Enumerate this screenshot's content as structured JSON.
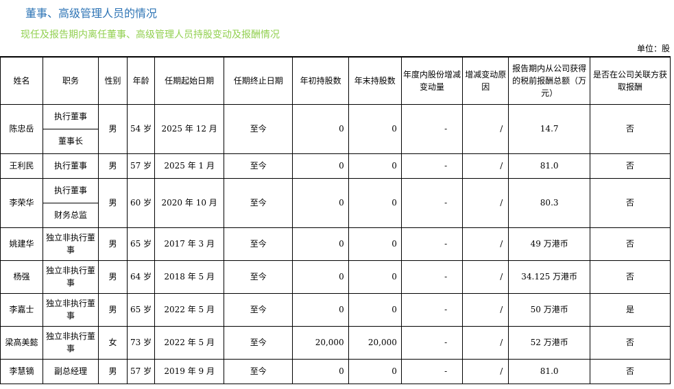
{
  "heading": "董事、高级管理人员的情况",
  "subheading": "现任及报告期内离任董事、高级管理人员持股变动及报酬情况",
  "unit": "单位：股",
  "columns": [
    "姓名",
    "职务",
    "性别",
    "年龄",
    "任期起始日期",
    "任期终止日期",
    "年初持股数",
    "年末持股数",
    "年度内股份增减变动量",
    "增减变动原因",
    "报告期内从公司获得的税前报酬总额（万元）",
    "是否在公司关联方获取报酬"
  ],
  "rows": [
    {
      "name": "陈忠岳",
      "roles": [
        "执行董事",
        "董事长"
      ],
      "gender": "男",
      "age": "54 岁",
      "start": "2025 年 12 月",
      "end": "至今",
      "begin_shares": "0",
      "end_shares": "0",
      "change": "-",
      "reason": "/",
      "pay": "14.7",
      "related": "否"
    },
    {
      "name": "王利民",
      "roles": [
        "执行董事"
      ],
      "gender": "男",
      "age": "57 岁",
      "start": "2025 年 1 月",
      "end": "至今",
      "begin_shares": "0",
      "end_shares": "0",
      "change": "-",
      "reason": "/",
      "pay": "81.0",
      "related": "否"
    },
    {
      "name": "李荣华",
      "roles": [
        "执行董事",
        "财务总监"
      ],
      "gender": "男",
      "age": "60 岁",
      "start": "2020 年 10 月",
      "end": "至今",
      "begin_shares": "0",
      "end_shares": "0",
      "change": "-",
      "reason": "/",
      "pay": "80.3",
      "related": "否"
    },
    {
      "name": "姚建华",
      "roles": [
        "独立非执行董事"
      ],
      "gender": "男",
      "age": "65 岁",
      "start": "2017 年 3 月",
      "end": "至今",
      "begin_shares": "0",
      "end_shares": "0",
      "change": "-",
      "reason": "/",
      "pay": "49 万港币",
      "related": "否"
    },
    {
      "name": "杨强",
      "roles": [
        "独立非执行董事"
      ],
      "gender": "男",
      "age": "64 岁",
      "start": "2018 年 5 月",
      "end": "至今",
      "begin_shares": "0",
      "end_shares": "0",
      "change": "-",
      "reason": "/",
      "pay": "34.125 万港币",
      "related": "否"
    },
    {
      "name": "李嘉士",
      "roles": [
        "独立非执行董事"
      ],
      "gender": "男",
      "age": "65 岁",
      "start": "2022 年 5 月",
      "end": "至今",
      "begin_shares": "0",
      "end_shares": "0",
      "change": "-",
      "reason": "/",
      "pay": "50 万港币",
      "related": "是"
    },
    {
      "name": "梁高美懿",
      "roles": [
        "独立非执行董事"
      ],
      "gender": "女",
      "age": "73 岁",
      "start": "2022 年 5 月",
      "end": "至今",
      "begin_shares": "20,000",
      "end_shares": "20,000",
      "change": "-",
      "reason": "/",
      "pay": "52 万港币",
      "related": "否"
    },
    {
      "name": "李慧镝",
      "roles": [
        "副总经理"
      ],
      "gender": "男",
      "age": "57 岁",
      "start": "2019 年 9 月",
      "end": "至今",
      "begin_shares": "0",
      "end_shares": "0",
      "change": "-",
      "reason": "/",
      "pay": "81.0",
      "related": "否"
    }
  ]
}
